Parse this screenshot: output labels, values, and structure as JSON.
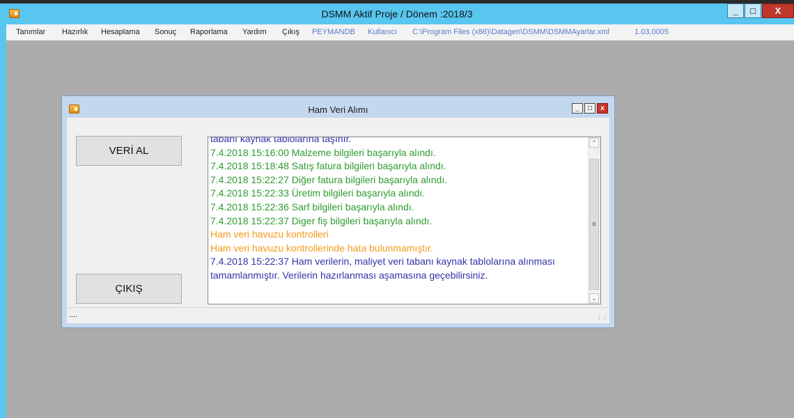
{
  "main_window": {
    "title": "DSMM Aktif Proje / Dönem :2018/3",
    "controls": {
      "minimize": "_",
      "maximize": "□",
      "close": "X"
    }
  },
  "menu": {
    "items": [
      "Tanımlar",
      "Hazırlık",
      "Hesaplama",
      "Sonuç",
      "Raporlama",
      "Yardım",
      "Çıkış"
    ],
    "info": [
      "PEYMANDB",
      "Kullanıcı",
      "C:\\Program Files (x86)\\Datagen\\DSMM\\DSMMAyarlar.xml",
      "1.03.0005"
    ]
  },
  "child_window": {
    "title": "Ham Veri Alımı",
    "controls": {
      "minimize": "_",
      "maximize": "□",
      "close": "x"
    },
    "buttons": {
      "get_data": "VERİ AL",
      "exit": "ÇIKIŞ"
    },
    "log": [
      {
        "text": "tabanı kaynak tablolarına taşınır.",
        "color": "#3333aa"
      },
      {
        "text": "7.4.2018 15:16:00 Malzeme bilgileri başarıyla alındı.",
        "color": "#2e9b2e"
      },
      {
        "text": "7.4.2018 15:18:48 Satış fatura bilgileri başarıyla alındı.",
        "color": "#2e9b2e"
      },
      {
        "text": "7.4.2018 15:22:27 Diğer fatura bilgileri başarıyla alındı.",
        "color": "#2e9b2e"
      },
      {
        "text": "7.4.2018 15:22:33 Üretim bilgileri başarıyla alındı.",
        "color": "#2e9b2e"
      },
      {
        "text": "7.4.2018 15:22:36 Sarf bilgileri başarıyla alındı.",
        "color": "#2e9b2e"
      },
      {
        "text": "7.4.2018 15:22:37 Diger fiş bilgileri başarıyla alındı.",
        "color": "#2e9b2e"
      },
      {
        "text": "Ham veri havuzu kontrolleri",
        "color": "#f29a1a"
      },
      {
        "text": "Ham veri havuzu kontrollerinde hata bulunmamıştır.",
        "color": "#f29a1a"
      },
      {
        "text": "7.4.2018 15:22:37 Ham verilerin, maliyet veri tabanı kaynak tablolarına alınması",
        "color": "#3333aa"
      },
      {
        "text": "tamamlanmıştır. Verilerin hazırlanması aşamasına geçebilirsiniz.",
        "color": "#3333aa"
      }
    ],
    "status_text": "...."
  },
  "icons": {
    "app": "app-icon",
    "scroll_up": "scroll-up-arrow-icon",
    "scroll_down": "scroll-down-arrow-icon",
    "grip": "size-grip-icon"
  }
}
